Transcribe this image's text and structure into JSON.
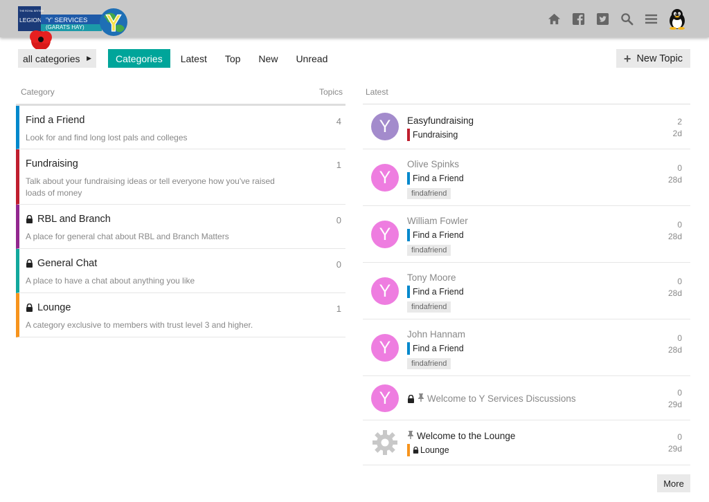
{
  "header": {
    "logo_text_1": "THE ROYAL BRITISH",
    "logo_text_2": "LEGION",
    "logo_text_3": "'Y' SERVICES",
    "logo_text_4": "(GARATS HAY)",
    "icons": [
      "home-icon",
      "facebook-icon",
      "twitter-icon",
      "search-icon",
      "hamburger-menu-icon",
      "user-avatar"
    ]
  },
  "nav": {
    "dropdown_label": "all categories",
    "tabs": [
      {
        "label": "Categories",
        "active": true
      },
      {
        "label": "Latest"
      },
      {
        "label": "Top"
      },
      {
        "label": "New"
      },
      {
        "label": "Unread"
      }
    ],
    "new_topic_label": "New Topic"
  },
  "categories": {
    "header_category": "Category",
    "header_topics": "Topics",
    "rows": [
      {
        "name": "Find a Friend",
        "desc": "Look for and find long lost pals and colleges",
        "count": "4",
        "color": "#0088cc",
        "locked": false
      },
      {
        "name": "Fundraising",
        "desc": "Talk about your fundraising ideas or tell everyone how you've raised loads of money",
        "count": "1",
        "color": "#bf1e2e",
        "locked": false
      },
      {
        "name": "RBL and Branch",
        "desc": "A place for general chat about RBL and Branch Matters",
        "count": "0",
        "color": "#92278f",
        "locked": true
      },
      {
        "name": "General Chat",
        "desc": "A place to have a chat about anything you like",
        "count": "0",
        "color": "#12a89d",
        "locked": true
      },
      {
        "name": "Lounge",
        "desc": "A category exclusive to members with trust level 3 and higher.",
        "count": "1",
        "color": "#f7941d",
        "locked": true
      }
    ]
  },
  "latest": {
    "header": "Latest",
    "rows": [
      {
        "title": "Easyfundraising",
        "category": "Fundraising",
        "cat_color": "#bf1e2e",
        "tag": "",
        "replies": "2",
        "age": "2d",
        "avatar_color": "#a38bcc",
        "avatar_letter": "Y",
        "read": false
      },
      {
        "title": "Olive Spinks",
        "category": "Find a Friend",
        "cat_color": "#0088cc",
        "tag": "findafriend",
        "replies": "0",
        "age": "28d",
        "avatar_color": "#ee7de0",
        "avatar_letter": "Y",
        "read": true
      },
      {
        "title": "William Fowler",
        "category": "Find a Friend",
        "cat_color": "#0088cc",
        "tag": "findafriend",
        "replies": "0",
        "age": "28d",
        "avatar_color": "#ee7de0",
        "avatar_letter": "Y",
        "read": true
      },
      {
        "title": "Tony Moore",
        "category": "Find a Friend",
        "cat_color": "#0088cc",
        "tag": "findafriend",
        "replies": "0",
        "age": "28d",
        "avatar_color": "#ee7de0",
        "avatar_letter": "Y",
        "read": true
      },
      {
        "title": "John Hannam",
        "category": "Find a Friend",
        "cat_color": "#0088cc",
        "tag": "findafriend",
        "replies": "0",
        "age": "28d",
        "avatar_color": "#ee7de0",
        "avatar_letter": "Y",
        "read": true
      },
      {
        "title": "Welcome to Y Services Discussions",
        "category": "",
        "cat_color": "",
        "tag": "",
        "replies": "0",
        "age": "29d",
        "avatar_color": "#ee7de0",
        "avatar_letter": "Y",
        "read": true,
        "locked": true,
        "pinned": true
      },
      {
        "title": "Welcome to the Lounge",
        "category": "Lounge",
        "cat_color": "#f7941d",
        "tag": "",
        "replies": "0",
        "age": "29d",
        "avatar_color": "gear",
        "avatar_letter": "",
        "read": false,
        "pinned": true,
        "cat_locked": true
      }
    ],
    "more_label": "More"
  }
}
